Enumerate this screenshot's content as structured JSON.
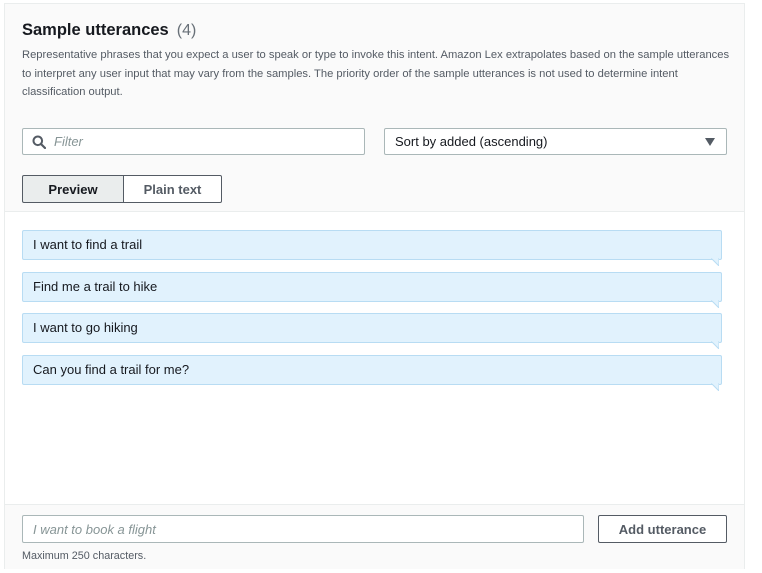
{
  "section": {
    "title": "Sample utterances",
    "count": "(4)",
    "description": "Representative phrases that you expect a user to speak or type to invoke this intent. Amazon Lex extrapolates based on the sample utterances to interpret any user input that may vary from the samples. The priority order of the sample utterances is not used to determine intent classification output."
  },
  "toolbar": {
    "filter": {
      "placeholder": "Filter",
      "value": "",
      "icon": "search-icon"
    },
    "sort": {
      "selected": "Sort by added (ascending)",
      "icon": "caret-down-icon"
    },
    "view_toggle": {
      "preview_label": "Preview",
      "plain_text_label": "Plain text",
      "active": "Preview"
    }
  },
  "utterances": [
    {
      "text": "I want to find a trail"
    },
    {
      "text": "Find me a trail to hike"
    },
    {
      "text": "I want to go hiking"
    },
    {
      "text": "Can you find a trail for me?"
    }
  ],
  "footer": {
    "input_placeholder": "I want to book a flight",
    "input_value": "",
    "add_label": "Add utterance",
    "hint": "Maximum 250 characters."
  },
  "colors": {
    "utterance_bg": "#e1f2fd",
    "utterance_border": "#b8dcf3",
    "panel_bg": "#fafafa",
    "active_toggle_bg": "#eaeded"
  }
}
